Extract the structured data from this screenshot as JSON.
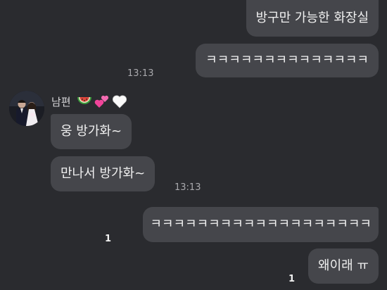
{
  "sender": {
    "name": "남편",
    "emojis": [
      "watermelon-icon",
      "two-hearts-icon",
      "white-heart-icon"
    ]
  },
  "messages": {
    "m1": {
      "text": "방구만 가능한 화장실",
      "direction": "outgoing"
    },
    "m2": {
      "text": "ㅋㅋㅋㅋㅋㅋㅋㅋㅋㅋㅋㅋㅋㅋ",
      "direction": "outgoing",
      "time": "13:13"
    },
    "m3": {
      "text": "웅 방가화~",
      "direction": "incoming"
    },
    "m4": {
      "text": "만나서 방가화~",
      "direction": "incoming",
      "time": "13:13"
    },
    "m5": {
      "text": "ㅋㅋㅋㅋㅋㅋㅋㅋㅋㅋㅋㅋㅋㅋㅋㅋㅋㅋㅋ",
      "direction": "outgoing",
      "unread": "1"
    },
    "m6": {
      "text": "왜이래 ㅠ",
      "direction": "outgoing",
      "unread": "1"
    }
  },
  "colors": {
    "background": "#2a2b2f",
    "bubble": "#45464b",
    "text": "#f0f0f0",
    "timestamp": "#a9a9ad"
  }
}
